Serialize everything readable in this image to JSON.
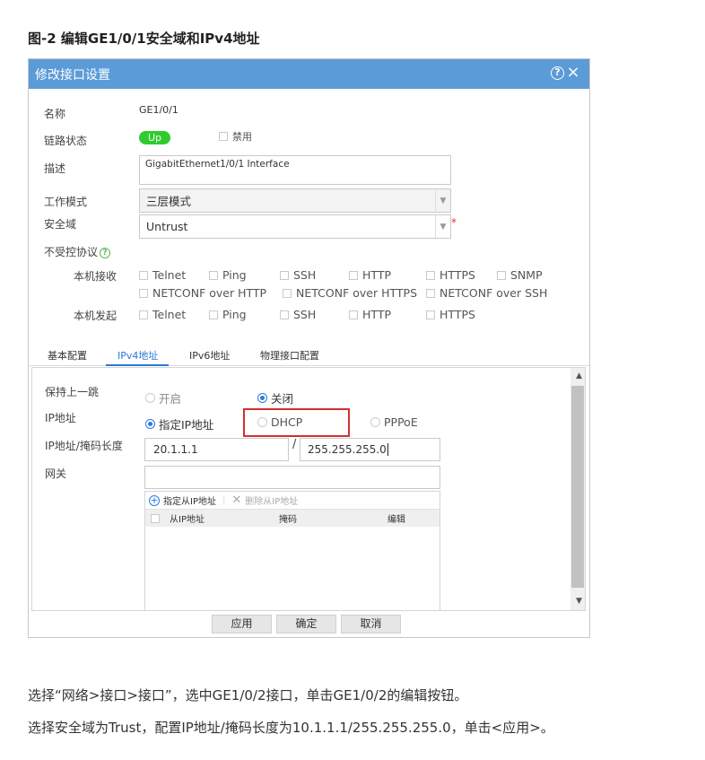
{
  "figure_title": "图-2 编辑GE1/0/1安全域和IPv4地址",
  "dialog": {
    "title": "修改接口设置",
    "help_icon": "?",
    "close_icon": "×",
    "name_label": "名称",
    "name_value": "GE1/0/1",
    "link_label": "链路状态",
    "link_status": "Up",
    "disable_label": "禁用",
    "desc_label": "描述",
    "desc_value": "GigabitEthernet1/0/1 Interface",
    "mode_label": "工作模式",
    "mode_value": "三层模式",
    "zone_label": "安全域",
    "zone_value": "Untrust",
    "required_mark": "*",
    "uncontrolled_label": "不受控协议",
    "recv_label": "本机接收",
    "recv_items": [
      "Telnet",
      "Ping",
      "SSH",
      "HTTP",
      "HTTPS",
      "SNMP",
      "NETCONF over HTTP",
      "NETCONF over HTTPS",
      "NETCONF over SSH"
    ],
    "send_label": "本机发起",
    "send_items": [
      "Telnet",
      "Ping",
      "SSH",
      "HTTP",
      "HTTPS"
    ],
    "tabs": [
      "基本配置",
      "IPv4地址",
      "IPv6地址",
      "物理接口配置"
    ],
    "active_tab": "IPv4地址",
    "keep_hop_label": "保持上一跳",
    "keep_on": "开启",
    "keep_off": "关闭",
    "ip_label": "IP地址",
    "ip_opt_static": "指定IP地址",
    "ip_opt_dhcp": "DHCP",
    "ip_opt_pppoe": "PPPoE",
    "ipmask_label": "IP地址/掩码长度",
    "ip_value": "20.1.1.1",
    "slash": "/",
    "mask_value": "255.255.255.0",
    "gateway_label": "网关",
    "gateway_value": "",
    "add_sub_ip": "指定从IP地址",
    "del_sub_ip": "删除从IP地址",
    "col_sub_ip": "从IP地址",
    "col_mask": "掩码",
    "col_edit": "编辑",
    "btn_apply": "应用",
    "btn_ok": "确定",
    "btn_cancel": "取消"
  },
  "instructions": [
    "选择“网络>接口>接口”，选中GE1/0/2接口，单击GE1/0/2的编辑按钮。",
    "选择安全域为Trust，配置IP地址/掩码长度为10.1.1.1/255.255.255.0，单击<应用>。"
  ],
  "colors": {
    "header_bg": "#5b9bd8",
    "up_badge": "#2ecc2e",
    "active_tab": "#2a7ad8",
    "highlight_box": "#d32f2f"
  }
}
